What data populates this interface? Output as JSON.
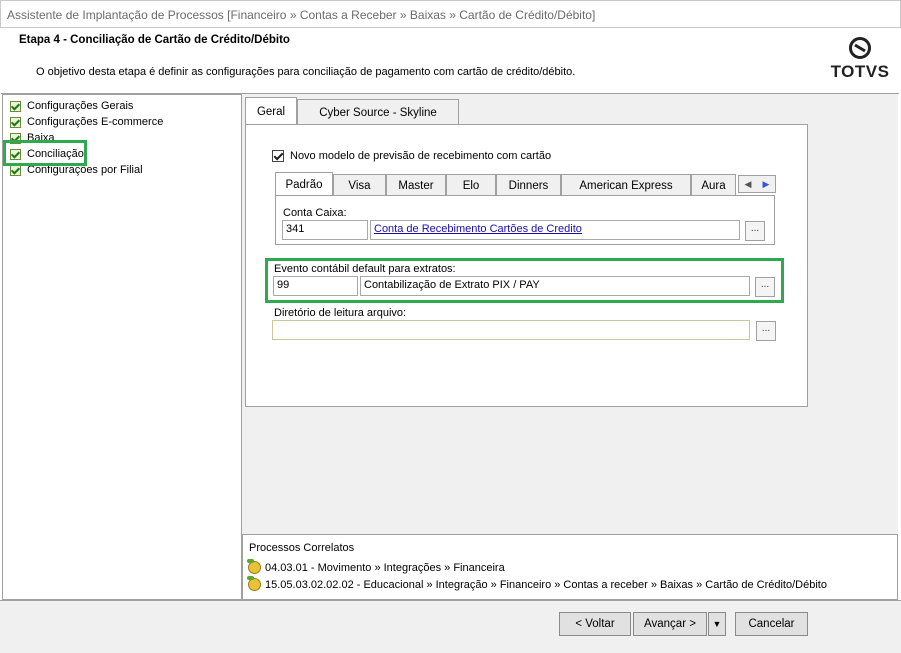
{
  "window": {
    "title": "Assistente de Implantação de Processos [Financeiro » Contas a Receber » Baixas » Cartão de Crédito/Débito]"
  },
  "header": {
    "step_title": "Etapa 4 - Conciliação de Cartão de Crédito/Débito",
    "description": "O objetivo desta etapa é definir as configurações para conciliação de pagamento com cartão de crédito/débito.",
    "logo_text": "TOTVS"
  },
  "sidebar": {
    "items": [
      {
        "label": "Configurações Gerais"
      },
      {
        "label": "Configurações E-commerce"
      },
      {
        "label": "Baixa"
      },
      {
        "label": "Conciliação"
      },
      {
        "label": "Configurações por Filial"
      }
    ]
  },
  "main_tabs": [
    {
      "label": "Geral"
    },
    {
      "label": "Cyber Source - Skyline"
    }
  ],
  "novo_modelo": {
    "label": "Novo modelo de previsão de recebimento com cartão",
    "checked": true
  },
  "card_tabs": [
    {
      "label": "Padrão"
    },
    {
      "label": "Visa"
    },
    {
      "label": "Master"
    },
    {
      "label": "Elo"
    },
    {
      "label": "Dinners"
    },
    {
      "label": "American Express"
    },
    {
      "label": "Aura"
    }
  ],
  "conta_caixa": {
    "label": "Conta Caixa:",
    "code": "341",
    "description": "Conta de Recebimento Cartões de Credito",
    "button": "..."
  },
  "evento": {
    "label": "Evento contábil default para extratos:",
    "code": "99",
    "description": "Contabilização de Extrato PIX / PAY",
    "button": "..."
  },
  "diretorio": {
    "label": "Diretório de leitura arquivo:",
    "value": "",
    "button": "..."
  },
  "processos": {
    "title": "Processos Correlatos",
    "items": [
      {
        "label": "04.03.01 - Movimento » Integrações » Financeira"
      },
      {
        "label": "15.05.03.02.02.02 - Educacional » Integração » Financeiro » Contas a receber » Baixas » Cartão de Crédito/Débito"
      }
    ]
  },
  "footer": {
    "back": "< Voltar",
    "next": "Avançar >",
    "cancel": "Cancelar"
  },
  "colors": {
    "highlight": "#2fa84f",
    "link": "#1a0dab"
  }
}
